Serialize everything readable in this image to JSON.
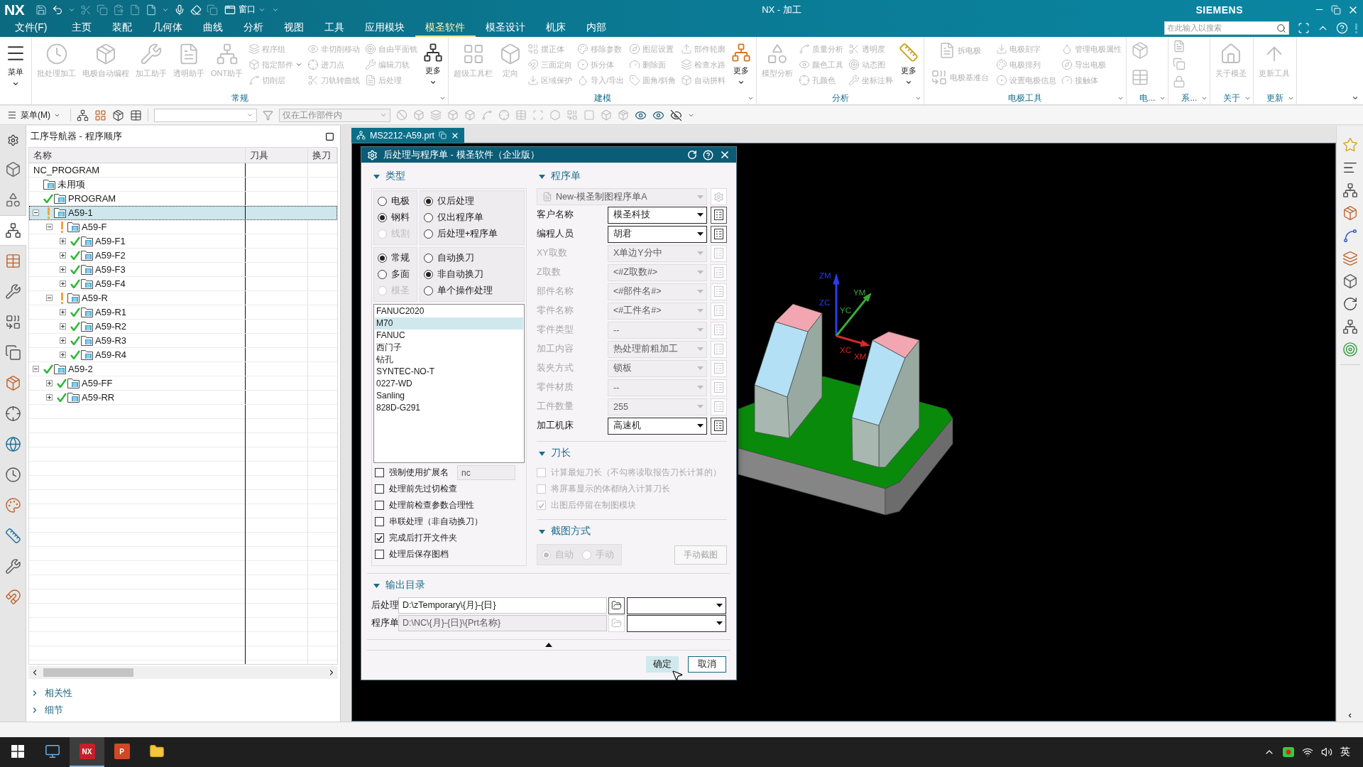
{
  "title_bar": {
    "logo": "NX",
    "window_menu": "窗口",
    "title": "NX - 加工",
    "brand": "SIEMENS"
  },
  "menu_tabs": [
    {
      "label": "文件(F)",
      "selected": false
    },
    {
      "label": "主页",
      "selected": false
    },
    {
      "label": "装配",
      "selected": false
    },
    {
      "label": "几何体",
      "selected": false
    },
    {
      "label": "曲线",
      "selected": false
    },
    {
      "label": "分析",
      "selected": false
    },
    {
      "label": "视图",
      "selected": false
    },
    {
      "label": "工具",
      "selected": false
    },
    {
      "label": "应用模块",
      "selected": false
    },
    {
      "label": "模圣软件",
      "selected": true
    },
    {
      "label": "模圣设计",
      "selected": false
    },
    {
      "label": "机床",
      "selected": false
    },
    {
      "label": "内部",
      "selected": false
    }
  ],
  "search": {
    "placeholder": "在此输入以搜索"
  },
  "ribbon": {
    "menu_button": {
      "label": "菜单"
    },
    "groups": [
      {
        "kind": "tools",
        "label": "常规",
        "large": [
          {
            "label": "批处理加工",
            "disabled": true
          },
          {
            "label": "电极自动编程",
            "disabled": true
          },
          {
            "label": "加工助手",
            "disabled": true
          },
          {
            "label": "透明助手",
            "disabled": true
          },
          {
            "label": "ONT助手",
            "disabled": true
          }
        ],
        "columns": [
          [
            {
              "label": "程序组",
              "disabled": true
            },
            {
              "label": "指定部件",
              "disabled": true,
              "menu": true
            },
            {
              "label": "切削层",
              "disabled": true
            }
          ],
          [
            {
              "label": "非切削移动",
              "disabled": true
            },
            {
              "label": "进刀点",
              "disabled": true
            },
            {
              "label": "刀轨转曲线",
              "disabled": true
            }
          ],
          [
            {
              "label": "自由平面铣",
              "disabled": true
            },
            {
              "label": "编辑刀轨",
              "disabled": true
            },
            {
              "label": "后处理",
              "disabled": true
            }
          ]
        ],
        "more": {
          "label": "更多",
          "disabled": false
        }
      },
      {
        "kind": "tools",
        "label": "建模",
        "large": [
          {
            "label": "超级工具栏",
            "disabled": true
          },
          {
            "label": "定向",
            "disabled": true
          }
        ],
        "columns": [
          [
            {
              "label": "摆正体",
              "disabled": true
            },
            {
              "label": "三面定向",
              "disabled": true
            },
            {
              "label": "区域保护",
              "disabled": true
            }
          ],
          [
            {
              "label": "移除参数",
              "disabled": true
            },
            {
              "label": "拆分体",
              "disabled": true
            },
            {
              "label": "导入/导出",
              "disabled": true
            }
          ],
          [
            {
              "label": "图层设置",
              "disabled": true
            },
            {
              "label": "删除面",
              "disabled": true
            },
            {
              "label": "圆角/斜角",
              "disabled": true
            }
          ],
          [
            {
              "label": "部件轮廓",
              "disabled": true
            },
            {
              "label": "检查水路",
              "disabled": true
            },
            {
              "label": "自动拼料",
              "disabled": true
            }
          ]
        ],
        "more": {
          "label": "更多",
          "disabled": false
        }
      },
      {
        "kind": "tools",
        "label": "分析",
        "large": [
          {
            "label": "模型分析",
            "disabled": true
          }
        ],
        "columns": [
          [
            {
              "label": "质量分析",
              "disabled": true
            },
            {
              "label": "颜色工具",
              "disabled": true
            },
            {
              "label": "孔颜色",
              "disabled": true
            }
          ],
          [
            {
              "label": "透明度",
              "disabled": true
            },
            {
              "label": "动态图",
              "disabled": true
            },
            {
              "label": "坐标注释",
              "disabled": true
            }
          ]
        ],
        "more": {
          "label": "更多",
          "disabled": false
        }
      },
      {
        "kind": "tools",
        "label": "电极工具",
        "columns": [
          [
            {
              "label": "拆电极",
              "disabled": true
            },
            {
              "label": "电极基准台",
              "disabled": true
            }
          ],
          [
            {
              "label": "电极刻字",
              "disabled": true
            },
            {
              "label": "电极排列",
              "disabled": true
            },
            {
              "label": "设置电极信息",
              "disabled": true
            }
          ],
          [
            {
              "label": "管理电极属性",
              "disabled": true
            },
            {
              "label": "导出电极",
              "disabled": true
            },
            {
              "label": "接触体",
              "disabled": true
            }
          ]
        ]
      },
      {
        "kind": "icons",
        "label": "电..."
      },
      {
        "kind": "icon_column",
        "label": "系..."
      },
      {
        "kind": "tools",
        "label": "关于",
        "large": [
          {
            "label": "关于模圣",
            "disabled": true
          }
        ]
      },
      {
        "kind": "tools",
        "label": "更新",
        "large": [
          {
            "label": "更新工具",
            "disabled": true
          }
        ]
      }
    ]
  },
  "toolbar": {
    "menu_label": "菜单(M)",
    "scope_filter": {
      "value": "仅在工作部件内",
      "disabled": true
    }
  },
  "left_toolbar": [
    {
      "selected": false
    },
    {
      "selected": false
    },
    {
      "selected": true
    },
    {
      "selected": false
    },
    {
      "selected": false
    },
    {
      "selected": false
    },
    {
      "selected": false
    },
    {
      "selected": false
    },
    {
      "selected": false
    },
    {
      "selected": false
    },
    {
      "selected": false
    },
    {
      "selected": false
    },
    {
      "selected": false
    },
    {
      "selected": false
    },
    {
      "selected": false
    }
  ],
  "navigator": {
    "title": "工序导航器 - 程序顺序",
    "columns": [
      "名称",
      "刀具",
      "换刀"
    ],
    "tree": [
      {
        "label": "NC_PROGRAM",
        "kind": "root",
        "selected": false,
        "children": [
          {
            "label": "未用项",
            "kind": "group",
            "selected": false
          },
          {
            "label": "PROGRAM",
            "kind": "complete",
            "selected": false
          },
          {
            "label": "A59-1",
            "kind": "modified",
            "selected": true,
            "expanded": true,
            "children": [
              {
                "label": "A59-F",
                "kind": "modified",
                "selected": false,
                "expanded": true,
                "children": [
                  {
                    "label": "A59-F1",
                    "kind": "complete",
                    "selected": false,
                    "expanded": false
                  },
                  {
                    "label": "A59-F2",
                    "kind": "complete",
                    "selected": false,
                    "expanded": false
                  },
                  {
                    "label": "A59-F3",
                    "kind": "complete",
                    "selected": false,
                    "expanded": false
                  },
                  {
                    "label": "A59-F4",
                    "kind": "complete",
                    "selected": false,
                    "expanded": false
                  }
                ]
              },
              {
                "label": "A59-R",
                "kind": "modified",
                "selected": false,
                "expanded": true,
                "children": [
                  {
                    "label": "A59-R1",
                    "kind": "complete",
                    "selected": false,
                    "expanded": false
                  },
                  {
                    "label": "A59-R2",
                    "kind": "complete",
                    "selected": false,
                    "expanded": false
                  },
                  {
                    "label": "A59-R3",
                    "kind": "complete",
                    "selected": false,
                    "expanded": false
                  },
                  {
                    "label": "A59-R4",
                    "kind": "complete",
                    "selected": false,
                    "expanded": false
                  }
                ]
              }
            ]
          },
          {
            "label": "A59-2",
            "kind": "complete",
            "selected": false,
            "expanded": true,
            "children": [
              {
                "label": "A59-FF",
                "kind": "complete",
                "selected": false,
                "expanded": false
              },
              {
                "label": "A59-RR",
                "kind": "complete",
                "selected": false,
                "expanded": false
              }
            ]
          }
        ]
      }
    ],
    "sections": [
      {
        "label": "相关性",
        "expanded": false
      },
      {
        "label": "细节",
        "expanded": false
      }
    ]
  },
  "document_tabs": [
    {
      "label": "MS2212-A59.prt",
      "selected": true
    }
  ],
  "dialog": {
    "title": "后处理与程序单 - 模圣软件（企业版）",
    "type_section": {
      "title": "类型",
      "expanded": true,
      "radio_groups": [
        [
          {
            "label": "电极",
            "selected": false,
            "disabled": false
          },
          {
            "label": "钢料",
            "selected": true,
            "disabled": false
          },
          {
            "label": "线割",
            "selected": false,
            "disabled": true
          }
        ],
        [
          {
            "label": "仅后处理",
            "selected": true,
            "disabled": false
          },
          {
            "label": "仅出程序单",
            "selected": false,
            "disabled": false
          },
          {
            "label": "后处理+程序单",
            "selected": false,
            "disabled": false
          }
        ],
        [
          {
            "label": "常规",
            "selected": true,
            "disabled": false
          },
          {
            "label": "多面",
            "selected": false,
            "disabled": false
          },
          {
            "label": "模圣",
            "selected": false,
            "disabled": true
          }
        ],
        [
          {
            "label": "自动换刀",
            "selected": false,
            "disabled": false
          },
          {
            "label": "非自动换刀",
            "selected": true,
            "disabled": false
          },
          {
            "label": "单个操作处理",
            "selected": false,
            "disabled": false
          }
        ]
      ],
      "posts": [
        {
          "label": "FANUC2020",
          "selected": false
        },
        {
          "label": "M70",
          "selected": true
        },
        {
          "label": "FANUC",
          "selected": false
        },
        {
          "label": "西门子",
          "selected": false
        },
        {
          "label": "钻孔",
          "selected": false
        },
        {
          "label": "SYNTEC-NO-T",
          "selected": false
        },
        {
          "label": "0227-WD",
          "selected": false
        },
        {
          "label": "Sanling",
          "selected": false
        },
        {
          "label": "828D-G291",
          "selected": false
        }
      ],
      "options": [
        {
          "label": "强制使用扩展名",
          "checked": false,
          "value": "nc"
        },
        {
          "label": "处理前先过切检查",
          "checked": false
        },
        {
          "label": "处理前检查参数合理性",
          "checked": false
        },
        {
          "label": "串联处理（非自动换刀）",
          "checked": false
        },
        {
          "label": "完成后打开文件夹",
          "checked": true
        },
        {
          "label": "处理后保存图档",
          "checked": false
        }
      ]
    },
    "sheet_section": {
      "title": "程序单",
      "expanded": true,
      "template": {
        "value": "New-模圣制图程序单A",
        "disabled": true
      },
      "fields": [
        {
          "label": "客户名称",
          "value": "模圣科技",
          "disabled": false
        },
        {
          "label": "编程人员",
          "value": "胡君",
          "disabled": false
        },
        {
          "label": "XY取数",
          "value": "X单边Y分中",
          "disabled": true
        },
        {
          "label": "Z取数",
          "value": "<#Z取数#>",
          "disabled": true
        },
        {
          "label": "部件名称",
          "value": "<#部件名#>",
          "disabled": true
        },
        {
          "label": "零件名称",
          "value": "<#工件名#>",
          "disabled": true
        },
        {
          "label": "零件类型",
          "value": "--",
          "disabled": true
        },
        {
          "label": "加工内容",
          "value": "热处理前粗加工",
          "disabled": true
        },
        {
          "label": "装夹方式",
          "value": "锁板",
          "disabled": true
        },
        {
          "label": "零件材质",
          "value": "--",
          "disabled": true
        },
        {
          "label": "工件数量",
          "value": "255",
          "disabled": true
        },
        {
          "label": "加工机床",
          "value": "高速机",
          "disabled": false
        }
      ]
    },
    "tool_length_section": {
      "title": "刀长",
      "expanded": true,
      "options": [
        {
          "label": "计算最短刀长（不勾将读取报告刀长计算的）",
          "checked": false,
          "disabled": true
        },
        {
          "label": "将屏幕显示的体都纳入计算刀长",
          "checked": false,
          "disabled": true
        },
        {
          "label": "出图后停留在制图模块",
          "checked": true,
          "disabled": true
        }
      ]
    },
    "capture_section": {
      "title": "截图方式",
      "expanded": true,
      "modes": [
        {
          "label": "自动",
          "selected": true,
          "disabled": true
        },
        {
          "label": "手动",
          "selected": false,
          "disabled": true
        }
      ],
      "button": {
        "label": "手动截图",
        "disabled": true
      }
    },
    "output_section": {
      "title": "输出目录",
      "expanded": true,
      "rows": [
        {
          "label": "后处理",
          "value": "D:\\zTemporary\\{月}-{日}",
          "disabled": false
        },
        {
          "label": "程序单",
          "value": "D:\\NC\\{月}-{日}\\{Prt名称}",
          "disabled": true
        }
      ]
    },
    "buttons": [
      {
        "label": "确定",
        "kind": "primary"
      },
      {
        "label": "取消",
        "kind": "secondary"
      }
    ]
  },
  "viewport": {
    "triad": [
      {
        "kind": "z",
        "labels": [
          "ZM",
          "ZC"
        ],
        "color": "#2a3cf0"
      },
      {
        "kind": "y",
        "labels": [
          "YM",
          "YC"
        ],
        "color": "#3aa83a"
      },
      {
        "kind": "x",
        "labels": [
          "XC",
          "XM"
        ],
        "color": "#d42a2a"
      }
    ]
  },
  "taskbar": {
    "apps": [
      {
        "kind": "monitor",
        "selected": false
      },
      {
        "kind": "nx",
        "label": "NX",
        "selected": true
      },
      {
        "kind": "slides",
        "label": "P",
        "selected": false
      },
      {
        "kind": "folder",
        "selected": false
      }
    ],
    "input_method": "英"
  }
}
